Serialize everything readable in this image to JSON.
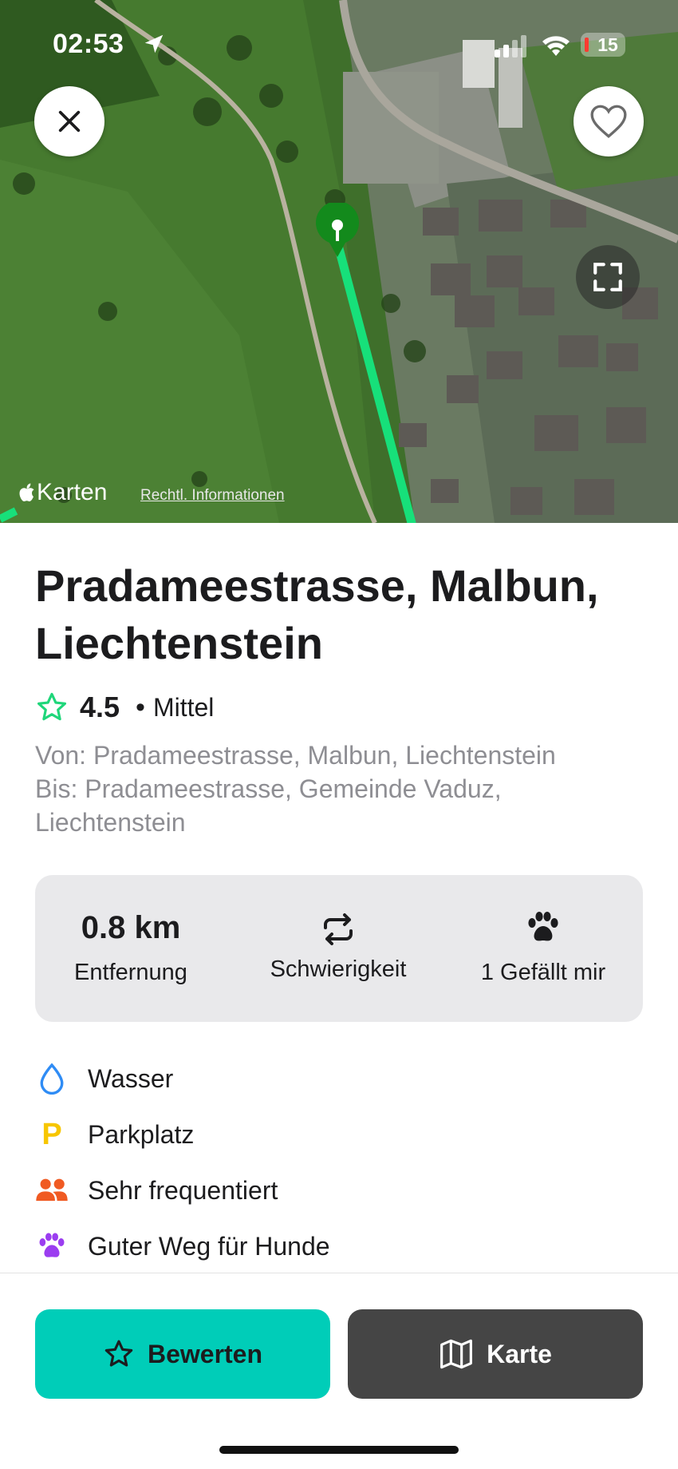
{
  "status_bar": {
    "time": "02:53",
    "battery": "15"
  },
  "map": {
    "credit": "Karten",
    "legal_link": "Rechtl. Informationen"
  },
  "trail": {
    "title": "Pradameestrasse, Malbun, Liechtenstein",
    "rating": "4.5",
    "difficulty": "Mittel",
    "from": "Von: Pradameestrasse, Malbun, Liechtenstein",
    "to": "Bis: Pradameestrasse, Gemeinde Vaduz, Liechtenstein"
  },
  "stats": {
    "distance_value": "0.8 km",
    "distance_label": "Entfernung",
    "difficulty_label": "Schwierigkeit",
    "likes_label": "1 Gefällt mir"
  },
  "features": [
    {
      "icon": "water-drop-icon",
      "label": "Wasser"
    },
    {
      "icon": "parking-icon",
      "label": "Parkplatz",
      "glyph": "P"
    },
    {
      "icon": "people-icon",
      "label": "Sehr frequentiert"
    },
    {
      "icon": "paw-icon",
      "label": "Guter Weg für Hunde"
    }
  ],
  "actions": {
    "rate_label": "Bewerten",
    "map_label": "Karte"
  },
  "colors": {
    "accent": "#00cdb8",
    "route_line": "#17e07a",
    "star": "#1fd67a",
    "water": "#2f8cf5",
    "parking": "#f7c600",
    "people": "#f05a22",
    "paw": "#9b3df0",
    "map_button": "#454545"
  }
}
